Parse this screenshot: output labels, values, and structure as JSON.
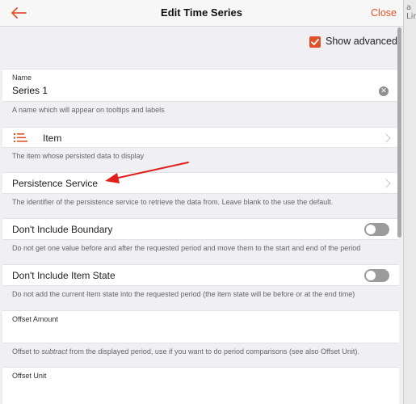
{
  "backdrop": {
    "top_right_text": "a Line"
  },
  "header": {
    "title": "Edit Time Series",
    "close_label": "Close"
  },
  "advanced": {
    "label": "Show advanced",
    "checked": true
  },
  "name_field": {
    "label": "Name",
    "value": "Series 1",
    "help": "A name which will appear on tooltips and labels"
  },
  "item_row": {
    "title": "Item",
    "help": "The item whose persisted data to display"
  },
  "persistence_row": {
    "title": "Persistence Service",
    "help": "The identifier of the persistence service to retrieve the data from. Leave blank to the use the default."
  },
  "boundary_row": {
    "title": "Don't Include Boundary",
    "enabled": false,
    "help": "Do not get one value before and after the requested period and move them to the start and end of the period"
  },
  "itemstate_row": {
    "title": "Don't Include Item State",
    "enabled": false,
    "help": "Do not add the current Item state into the requested period (the item state will be before or at the end time)"
  },
  "offset_amount": {
    "label": "Offset Amount",
    "value": "",
    "help_before": "Offset to ",
    "help_emph": "subtract",
    "help_after": " from the displayed period, use if you want to do period comparisons (see also Offset Unit)."
  },
  "offset_unit": {
    "label": "Offset Unit"
  },
  "colors": {
    "accent": "#e2522a",
    "arrow": "#e0201c"
  }
}
